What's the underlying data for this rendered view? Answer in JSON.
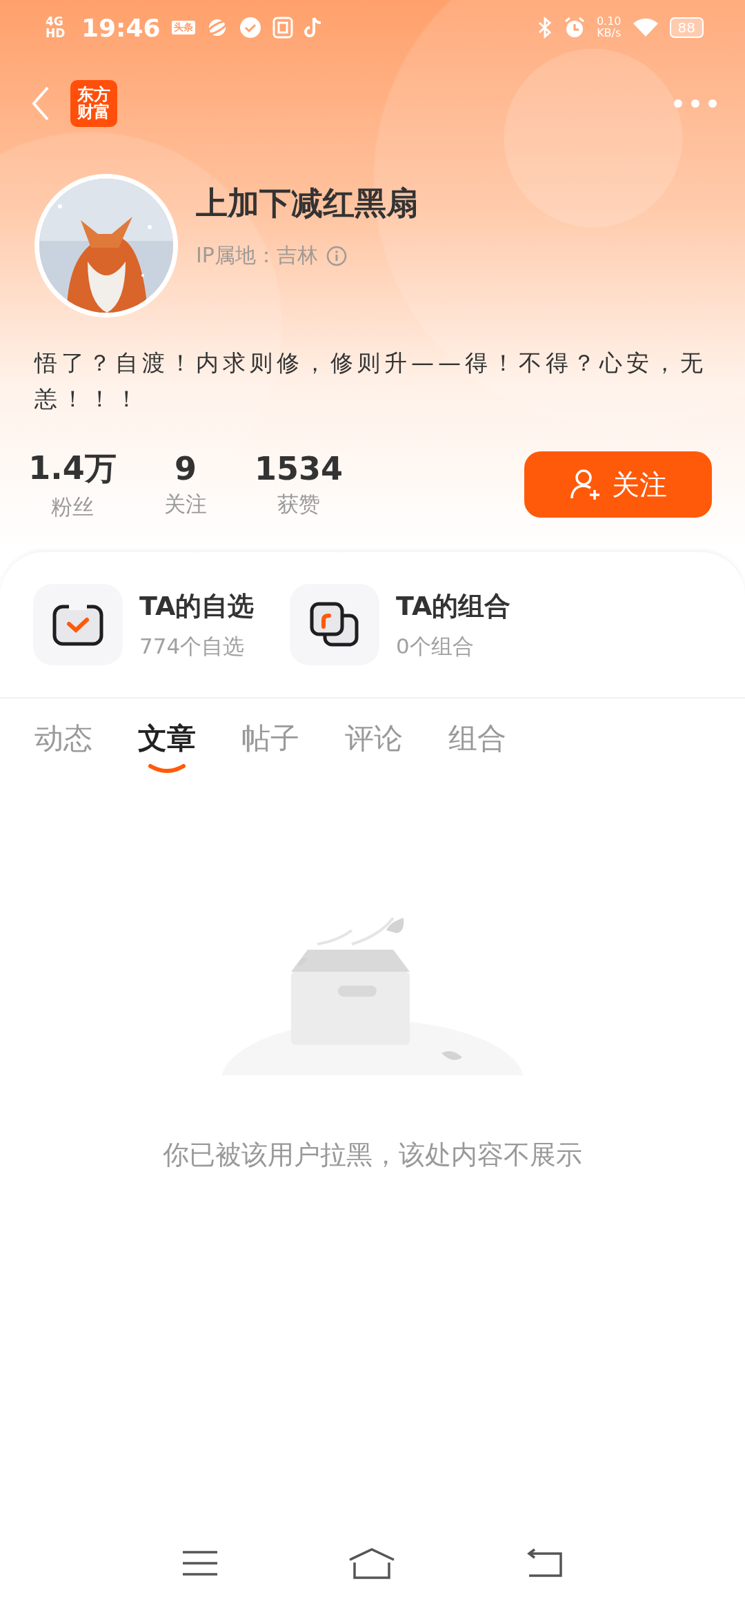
{
  "status_bar": {
    "network": "4GHD",
    "time": "19:46",
    "app_badge": "头条",
    "speed": "0.10",
    "speed_unit": "KB/s",
    "battery": "88"
  },
  "header": {
    "logo_lines": [
      "东方",
      "财富"
    ]
  },
  "profile": {
    "name": "上加下减红黑扇",
    "ip_location": "IP属地：吉林",
    "bio": "悟了？自渡！内求则修，修则升——得！不得？心安，无恙！！！",
    "stats": [
      {
        "value": "1.4万",
        "label": "粉丝"
      },
      {
        "value": "9",
        "label": "关注"
      },
      {
        "value": "1534",
        "label": "获赞"
      }
    ],
    "follow_button": "关注"
  },
  "shortcuts": [
    {
      "kind": "watchlist",
      "title": "TA的自选",
      "subtitle": "774个自选"
    },
    {
      "kind": "portfolio",
      "title": "TA的组合",
      "subtitle": "0个组合"
    }
  ],
  "tabs": [
    {
      "label": "动态",
      "selected": false
    },
    {
      "label": "文章",
      "selected": true
    },
    {
      "label": "帖子",
      "selected": false
    },
    {
      "label": "评论",
      "selected": false
    },
    {
      "label": "组合",
      "selected": false
    }
  ],
  "empty_message": "你已被该用户拉黑，该处内容不展示"
}
